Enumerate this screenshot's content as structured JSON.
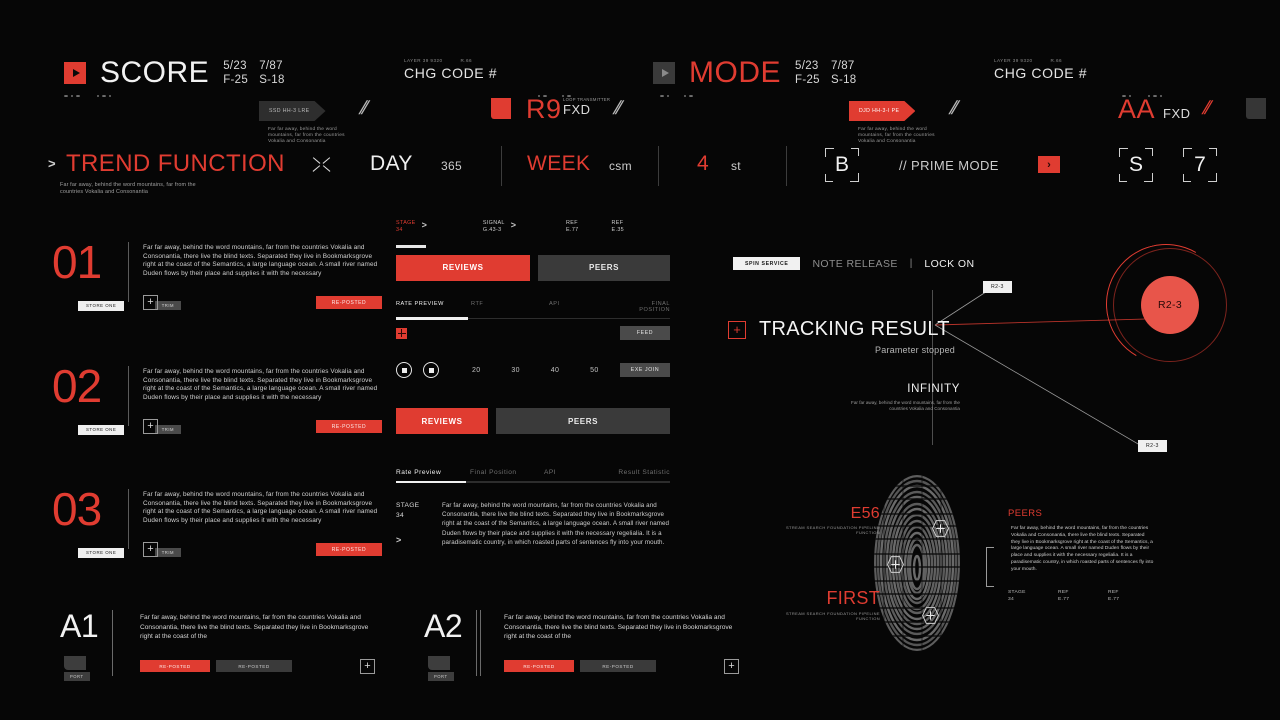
{
  "header": {
    "cells": [
      {
        "title": "SCORE",
        "nums": [
          "5/23",
          "7/87",
          "F-25",
          "S-18"
        ],
        "tag": "SSD HH-3 LRE",
        "note": "Far far away, behind the word mountains, far from the countries Vokalia and Consonantia"
      },
      {
        "kicker_left": "LAYER 39 9320",
        "kicker_right": "R.66",
        "label": "CHG CODE #",
        "code": "R9",
        "code_caption": "LOOP TRANSMITTER",
        "code_unit": "FXD"
      },
      {
        "title": "MODE",
        "nums": [
          "5/23",
          "7/87",
          "F-25",
          "S-18"
        ],
        "tag": "DJD HH-3-I PE",
        "note": "Far far away, behind the word mountains, far from the countries Vokalia and Consonantia"
      },
      {
        "kicker_left": "LAYER 39 9320",
        "kicker_right": "R.66",
        "label": "CHG CODE #",
        "code": "AA",
        "code_unit": "FXD"
      }
    ],
    "slash": "//"
  },
  "trend": {
    "arrow": ">",
    "title": "TREND FUNCTION",
    "subtitle": "Far far away, behind the word mountains, far from the countries Vokalia and Consonantia",
    "stats": [
      {
        "label": "DAY",
        "value": "365"
      },
      {
        "label": "WEEK",
        "value": "csm"
      },
      {
        "label": "4",
        "value": "st"
      }
    ],
    "bracket_b": "B",
    "prime_mode": "// PRIME MODE",
    "chip": "›",
    "bracket_s": "S",
    "bracket_7": "7"
  },
  "items": [
    {
      "num": "01",
      "chip_white": "STORE ONE",
      "chip_grey": "TRIM",
      "text": "Far far away, behind the word mountains, far from the countries Vokalia and Consonantia, there live the blind texts. Separated they live in Bookmarksgrove right at the coast of the Semantics, a large language ocean. A small river named Duden flows by their place and supplies it with the necessary",
      "button": "RE-POSTED"
    },
    {
      "num": "02",
      "chip_white": "STORE ONE",
      "chip_grey": "TRIM",
      "text": "Far far away, behind the word mountains, far from the countries Vokalia and Consonantia, there live the blind texts. Separated they live in Bookmarksgrove right at the coast of the Semantics, a large language ocean. A small river named Duden flows by their place and supplies it with the necessary",
      "button": "RE-POSTED"
    },
    {
      "num": "03",
      "chip_white": "STORE ONE",
      "chip_grey": "TRIM",
      "text": "Far far away, behind the word mountains, far from the countries Vokalia and Consonantia, there live the blind texts. Separated they live in Bookmarksgrove right at the coast of the Semantics, a large language ocean. A small river named Duden flows by their place and supplies it with the necessary",
      "button": "RE-POSTED"
    }
  ],
  "center": {
    "breadcrumbs": [
      {
        "k": "STAGE",
        "v": "34"
      },
      {
        "k": "SIGNAL",
        "v": "G.43-3"
      },
      {
        "k": "REF",
        "v": "E.77"
      },
      {
        "k": "REF",
        "v": "E.35"
      }
    ],
    "separator": ">",
    "tabs_top": {
      "active": "REVIEWS",
      "inactive": "PEERS"
    },
    "subtabs_top": [
      "RATE PREVIEW",
      "RTF",
      "API",
      "FINAL POSITION"
    ],
    "subtabs_top_active": "RATE PREVIEW",
    "feed_button": "FEED",
    "exe_button": "EXE JOIN",
    "scale": [
      "20",
      "30",
      "40",
      "50"
    ],
    "tabs_bottom": {
      "active": "REVIEWS",
      "inactive": "PEERS"
    },
    "subtabs_bottom": [
      "Rate Preview",
      "Final Position",
      "API",
      "Result Statistic"
    ],
    "subtabs_bottom_active": "Rate Preview",
    "stage_label": "STAGE",
    "stage_value": "34",
    "stage_arrow": ">",
    "stage_text": "Far far away, behind the word mountains, far from the countries Vokalia and Consonantia, there live the blind texts. Separated they live in Bookmarksgrove right at the coast of the Semantics, a large language ocean. A small river named Duden flows by their place and supplies it with the necessary regelialia. It is a paradisematic country, in which roasted parts of sentences fly into your mouth."
  },
  "right": {
    "spin_service": "SPIN SERVICE",
    "note_release": "NOTE RELEASE",
    "lock_on": "LOCK ON",
    "divider": "|",
    "tracking_title": "TRACKING RESULT",
    "tracking_sub": "Parameter stopped",
    "infinity_title": "INFINITY",
    "infinity_sub": "Far far away, behind the word mountains, far from the countries Vokalia and Consonantia",
    "tag_top": "R2-3",
    "tag_bottom": "R2-3",
    "radar_label": "R2-3",
    "e56": {
      "title": "E56",
      "sub": "STREAM SEARCH FOUNDATION PIPELINE FUNCTION"
    },
    "first": {
      "title": "FIRST",
      "sub": "STREAM SEARCH FOUNDATION PIPELINE FUNCTION"
    },
    "peers": {
      "title": "PEERS",
      "text": "Far far away, behind the word mountains, far from the countries Vokalia and Consonantia, there live the blind texts. Separated they live in Bookmarksgrove right at the coast of the Semantics, a large language ocean. A small river named Duden flows by their place and supplies it with the necessary regelialia. It is a paradisematic country, in which roasted parts of sentences fly into your mouth.",
      "meta": [
        {
          "k": "STAGE",
          "v": "34"
        },
        {
          "k": "REF",
          "v": "E.77"
        },
        {
          "k": "REF",
          "v": "E.77"
        }
      ]
    }
  },
  "bottom": [
    {
      "code": "A1",
      "port": "PORT",
      "text": "Far far away, behind the word mountains, far from the countries Vokalia and Consonantia, there live the blind texts. Separated they live in Bookmarksgrove right at the coast of the",
      "b1": "RE-POSTED",
      "b2": "RE-POSTED"
    },
    {
      "code": "A2",
      "port": "PORT",
      "text": "Far far away, behind the word mountains, far from the countries Vokalia and Consonantia, there live the blind texts. Separated they live in Bookmarksgrove right at the coast of the",
      "b1": "RE-POSTED",
      "b2": "RE-POSTED"
    }
  ],
  "colors": {
    "accent": "#e03c31",
    "bg": "#050505",
    "panel": "#3a3a3a"
  }
}
